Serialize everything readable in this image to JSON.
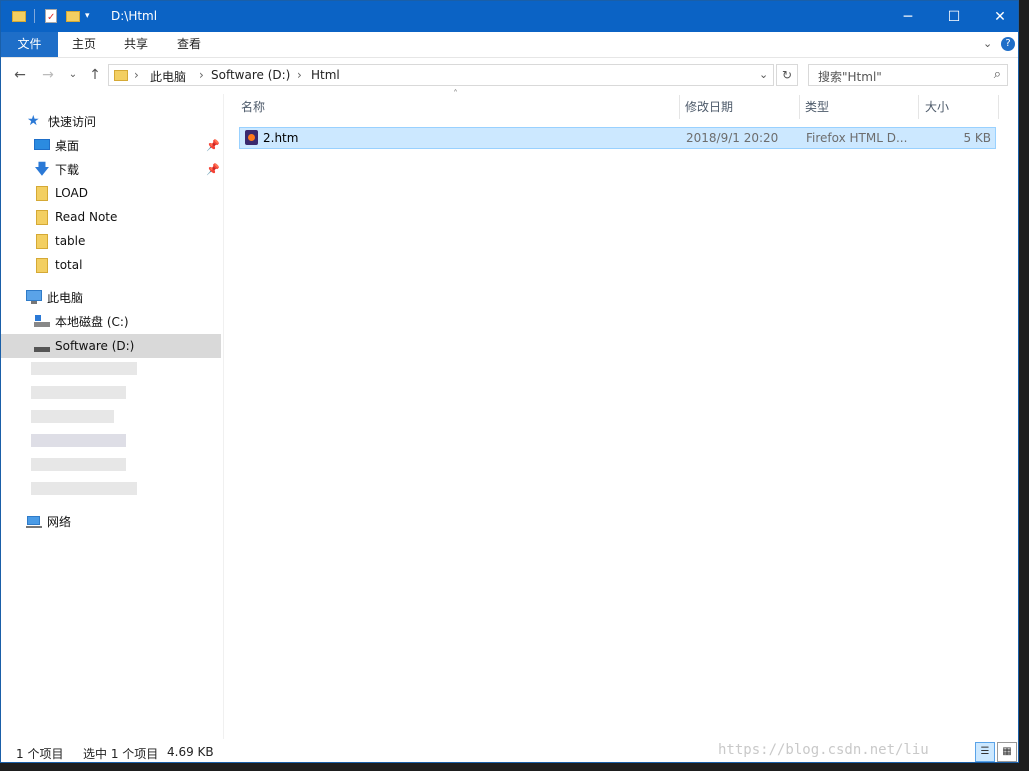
{
  "window": {
    "title": "D:\\Html"
  },
  "ribbon": {
    "tabs": [
      "文件",
      "主页",
      "共享",
      "查看"
    ]
  },
  "address": {
    "crumbs": [
      "此电脑",
      "Software (D:)",
      "Html"
    ],
    "search_placeholder": "搜索\"Html\""
  },
  "nav": {
    "quick_access": "快速访问",
    "pinned": [
      "桌面",
      "下载"
    ],
    "folders": [
      "LOAD",
      "Read Note",
      "table",
      "total"
    ],
    "this_pc": "此电脑",
    "drives": [
      "本地磁盘 (C:)",
      "Software (D:)"
    ],
    "network": "网络"
  },
  "files": {
    "columns": [
      "名称",
      "修改日期",
      "类型",
      "大小"
    ],
    "rows": [
      {
        "name": "2.htm",
        "date": "2018/9/1 20:20",
        "type": "Firefox HTML D...",
        "size": "5 KB"
      }
    ]
  },
  "status": {
    "count": "1 个项目",
    "selected": "选中 1 个项目",
    "size": "4.69 KB"
  },
  "watermark": "https://blog.csdn.net/liu",
  "colors": {
    "titlebar": "#0b63c5",
    "selection": "#cce8ff",
    "file_tab": "#1e6ec8"
  }
}
